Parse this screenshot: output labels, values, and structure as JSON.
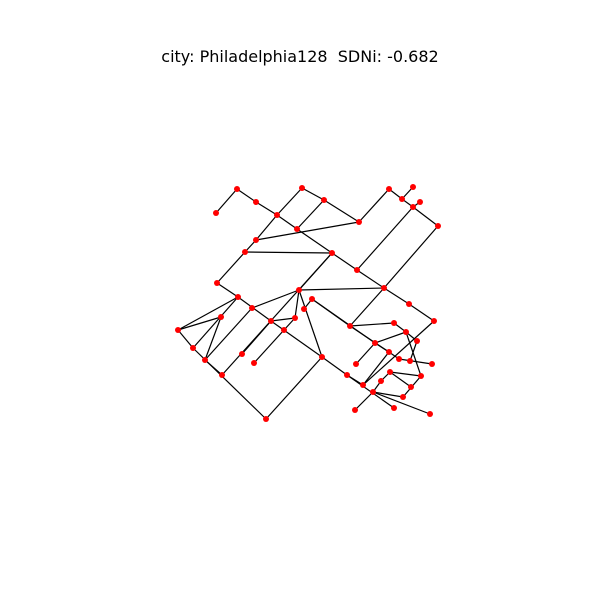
{
  "title": "city: Philadelphia128  SDNi: -0.682",
  "colors": {
    "node": "#ff0000",
    "edge": "#000000",
    "background": "#ffffff"
  }
}
